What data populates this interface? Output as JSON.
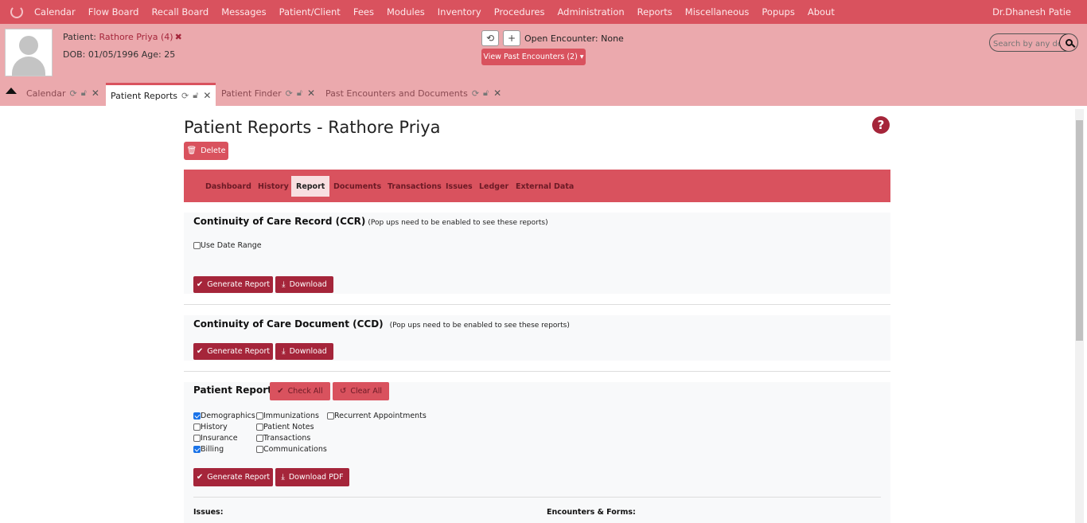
{
  "menu": [
    "Calendar",
    "Flow Board",
    "Recall Board",
    "Messages",
    "Patient/Client",
    "Fees",
    "Modules",
    "Inventory",
    "Procedures",
    "Administration",
    "Reports",
    "Miscellaneous",
    "Popups",
    "About"
  ],
  "user": "Dr.Dhanesh Patie",
  "patient": {
    "label": "Patient: ",
    "name": "Rathore Priya (4)",
    "close": "✖",
    "dob_line": "DOB: 01/05/1996 Age: 25"
  },
  "encounter": {
    "open_label": "Open Encounter: None",
    "past_button": "View Past Encounters  (2) ▾"
  },
  "search": {
    "placeholder": "Search by any demographics"
  },
  "tabs": [
    {
      "label": "Calendar"
    },
    {
      "label": "Patient Reports"
    },
    {
      "label": "Patient Finder"
    },
    {
      "label": "Past Encounters and Documents"
    }
  ],
  "page": {
    "title": "Patient Reports - Rathore Priya",
    "help": "?",
    "delete": "Delete"
  },
  "nav": [
    "Dashboard",
    "History",
    "Report",
    "Documents",
    "Transactions",
    "Issues",
    "Ledger",
    "External Data"
  ],
  "nav_active": "Report",
  "ccr": {
    "title": "Continuity of Care Record (CCR)",
    "note": "(Pop ups need to be enabled to see these reports)",
    "date_range": "Use Date Range",
    "generate": "Generate Report",
    "download": "Download"
  },
  "ccd": {
    "title": "Continuity of Care Document (CCD)",
    "note": "(Pop ups need to be enabled to see these reports)",
    "generate": "Generate Report",
    "download": "Download"
  },
  "patient_report": {
    "title": "Patient Report",
    "check_all": "Check All",
    "clear_all": "Clear All",
    "options": {
      "demographics": {
        "label": "Demographics",
        "checked": true
      },
      "history": {
        "label": "History",
        "checked": false
      },
      "insurance": {
        "label": "Insurance",
        "checked": false
      },
      "billing": {
        "label": "Billing",
        "checked": true
      },
      "immunizations": {
        "label": "Immunizations",
        "checked": false
      },
      "patient_notes": {
        "label": "Patient Notes",
        "checked": false
      },
      "transactions": {
        "label": "Transactions",
        "checked": false
      },
      "communications": {
        "label": "Communications",
        "checked": false
      },
      "recurrent": {
        "label": "Recurrent Appointments",
        "checked": false
      }
    },
    "generate": "Generate Report",
    "download_pdf": "Download PDF",
    "issues_label": "Issues:",
    "encounters_label": "Encounters & Forms:"
  },
  "colors": {
    "menu_bg": "#d9525e",
    "header_bg": "#eba9ad",
    "dark_btn": "#a5253a"
  }
}
